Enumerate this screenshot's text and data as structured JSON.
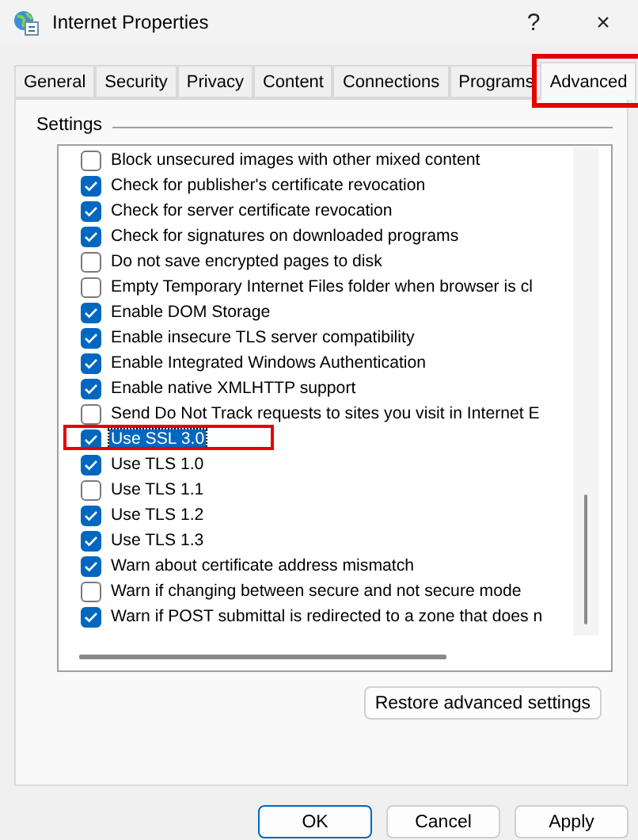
{
  "window": {
    "title": "Internet Properties",
    "help": "?",
    "close": "×"
  },
  "tabs": [
    {
      "label": "General",
      "selected": false,
      "highlighted": false
    },
    {
      "label": "Security",
      "selected": false,
      "highlighted": false
    },
    {
      "label": "Privacy",
      "selected": false,
      "highlighted": false
    },
    {
      "label": "Content",
      "selected": false,
      "highlighted": false
    },
    {
      "label": "Connections",
      "selected": false,
      "highlighted": false
    },
    {
      "label": "Programs",
      "selected": false,
      "highlighted": false
    },
    {
      "label": "Advanced",
      "selected": true,
      "highlighted": true
    }
  ],
  "settings": {
    "title": "Settings",
    "items": [
      {
        "label": "Block unsecured images with other mixed content",
        "checked": false,
        "selected": false,
        "highlighted": false
      },
      {
        "label": "Check for publisher's certificate revocation",
        "checked": true,
        "selected": false,
        "highlighted": false
      },
      {
        "label": "Check for server certificate revocation",
        "checked": true,
        "selected": false,
        "highlighted": false
      },
      {
        "label": "Check for signatures on downloaded programs",
        "checked": true,
        "selected": false,
        "highlighted": false
      },
      {
        "label": "Do not save encrypted pages to disk",
        "checked": false,
        "selected": false,
        "highlighted": false
      },
      {
        "label": "Empty Temporary Internet Files folder when browser is cl",
        "checked": false,
        "selected": false,
        "highlighted": false
      },
      {
        "label": "Enable DOM Storage",
        "checked": true,
        "selected": false,
        "highlighted": false
      },
      {
        "label": "Enable insecure TLS server compatibility",
        "checked": true,
        "selected": false,
        "highlighted": false
      },
      {
        "label": "Enable Integrated Windows Authentication",
        "checked": true,
        "selected": false,
        "highlighted": false
      },
      {
        "label": "Enable native XMLHTTP support",
        "checked": true,
        "selected": false,
        "highlighted": false
      },
      {
        "label": "Send Do Not Track requests to sites you visit in Internet E",
        "checked": false,
        "selected": false,
        "highlighted": false
      },
      {
        "label": "Use SSL 3.0",
        "checked": true,
        "selected": true,
        "highlighted": true
      },
      {
        "label": "Use TLS 1.0",
        "checked": true,
        "selected": false,
        "highlighted": false
      },
      {
        "label": "Use TLS 1.1",
        "checked": false,
        "selected": false,
        "highlighted": false
      },
      {
        "label": "Use TLS 1.2",
        "checked": true,
        "selected": false,
        "highlighted": false
      },
      {
        "label": "Use TLS 1.3",
        "checked": true,
        "selected": false,
        "highlighted": false
      },
      {
        "label": "Warn about certificate address mismatch",
        "checked": true,
        "selected": false,
        "highlighted": false
      },
      {
        "label": "Warn if changing between secure and not secure mode",
        "checked": false,
        "selected": false,
        "highlighted": false
      },
      {
        "label": "Warn if POST submittal is redirected to a zone that does n",
        "checked": true,
        "selected": false,
        "highlighted": false
      }
    ],
    "restore_button": "Restore advanced settings"
  },
  "buttons": [
    {
      "label": "OK",
      "default": true
    },
    {
      "label": "Cancel",
      "default": false
    },
    {
      "label": "Apply",
      "default": false
    }
  ]
}
